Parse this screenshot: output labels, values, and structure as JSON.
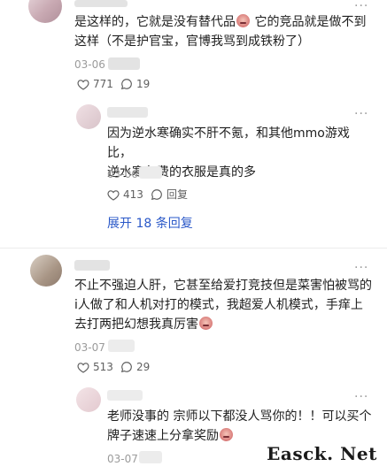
{
  "comments": [
    {
      "text_line1_a": "是这样的，它就是没有替代品",
      "text_line1_b": "它的竞品就是做不到",
      "text_line2": "这样（不是护官宝，官博我骂到成铁粉了）",
      "date": "03-06",
      "likes": "771",
      "replies": "19"
    },
    {
      "text_line1": "因为逆水寒确实不肝不氪，和其他mmo游戏比，",
      "text_line2": "逆水寒免费的衣服是真的多",
      "date": "03-06",
      "likes": "413",
      "reply_label": "回复"
    },
    {
      "expand_label": "展开 18 条回复"
    },
    {
      "text_line1": "不止不强迫人肝，它甚至给爱打竞技但是菜害怕被骂的",
      "text_line2": "i人做了和人机对打的模式，我超爱人机模式，手痒上",
      "text_line3": "去打两把幻想我真厉害",
      "date": "03-07",
      "likes": "513",
      "replies": "29"
    },
    {
      "text_line1": "老师没事的 宗师以下都没人骂你的！！可以买个",
      "text_line2": "牌子速速上分拿奖励",
      "date": "03-07"
    }
  ],
  "more_glyph": "···",
  "icons": [
    "heart-icon",
    "comment-icon",
    "emoji-icon"
  ],
  "watermark": "Easck. Net",
  "colors": {
    "link": "#2a58c8",
    "meta": "#5f5f5f",
    "date": "#9b9b9b"
  }
}
